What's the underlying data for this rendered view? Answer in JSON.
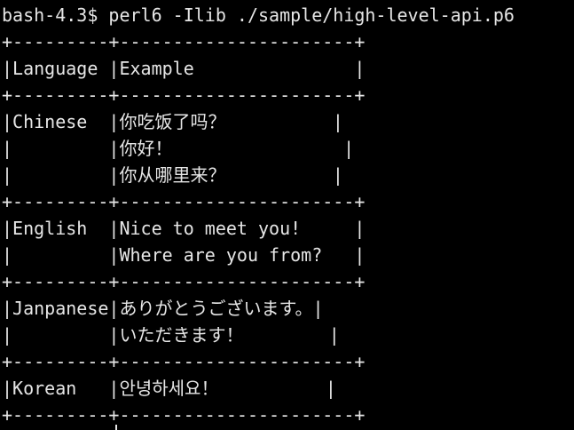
{
  "terminal": {
    "prompt": "bash-4.3$ perl6 -Ilib ./sample/high-level-api.p6",
    "lines": [
      "+---------+----------------------+",
      "|Language |Example               |",
      "+---------+----------------------+",
      "|Chinese  |你吃饭了吗？          |",
      "|         |你好！                |",
      "|         |你从哪里来？          |",
      "+---------+----------------------+",
      "|English  |Nice to meet you!     |",
      "|         |Where are you from?   |",
      "+---------+----------------------+",
      "|Janpanese|ありがとうございます。|",
      "|         |いただきます！        |",
      "+---------+----------------------+",
      "|Korean   |안녕하세요！          |",
      "+---------+----------------------+"
    ]
  }
}
